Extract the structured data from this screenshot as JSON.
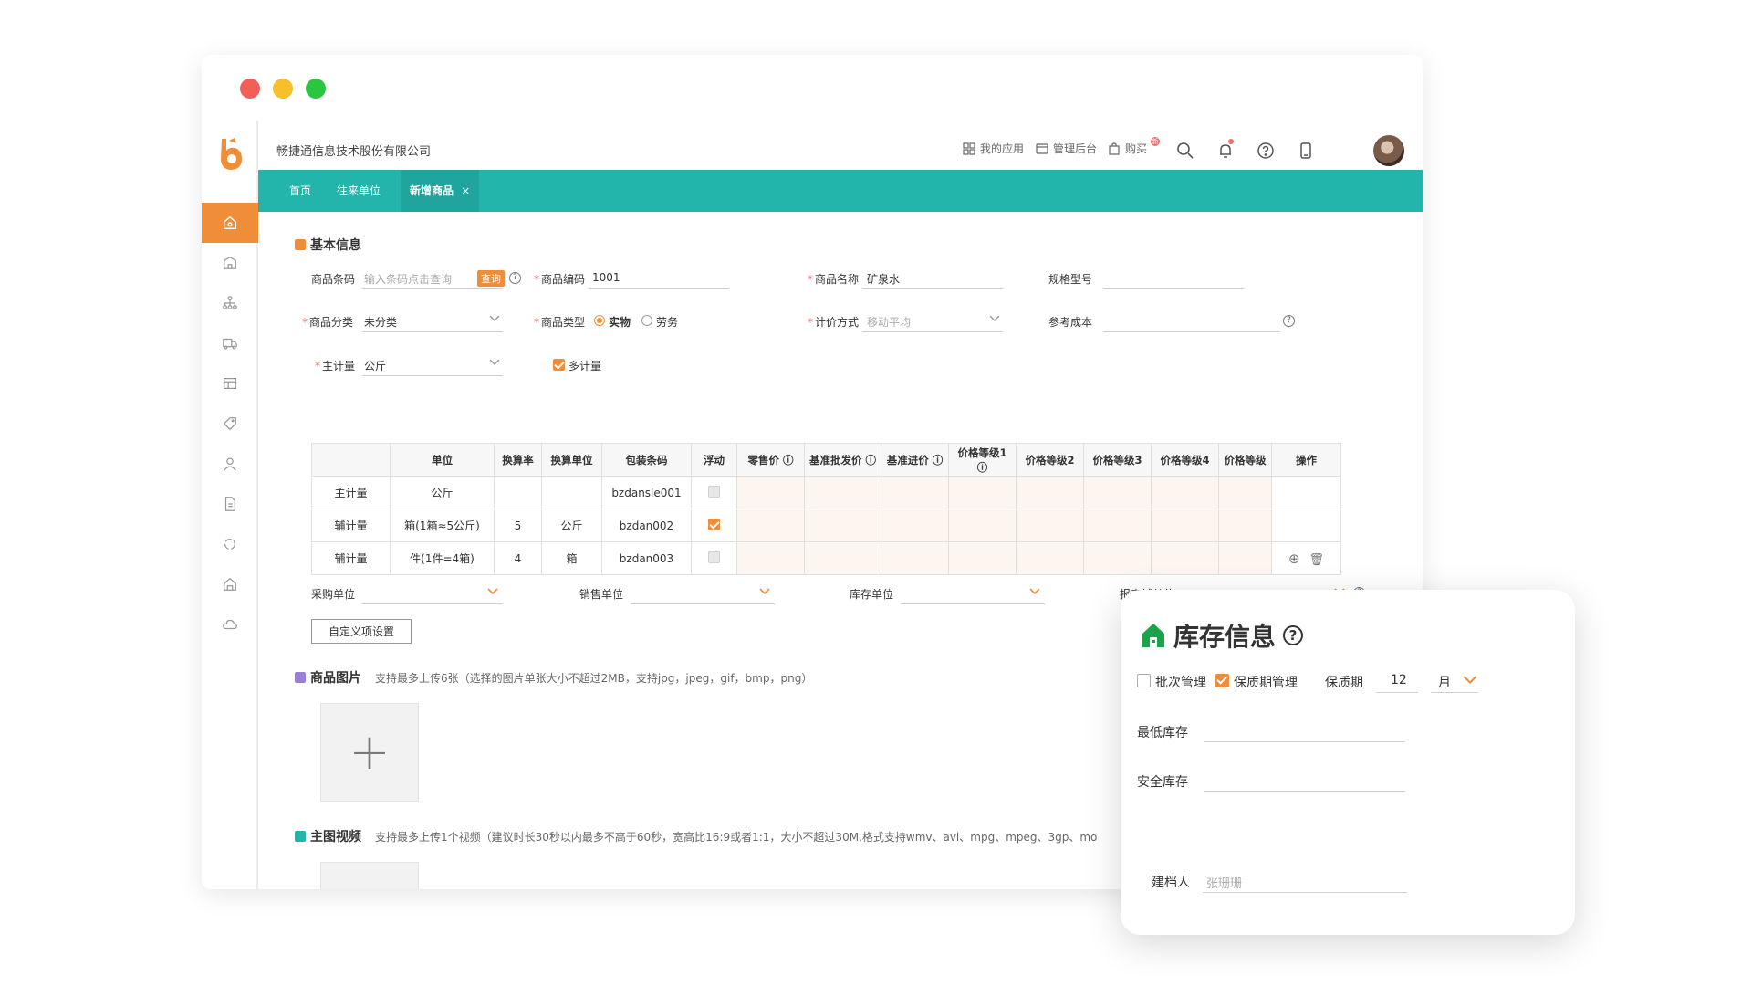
{
  "header": {
    "company": "畅捷通信息技术股份有限公司",
    "links": [
      "我的应用",
      "管理后台",
      "购买"
    ]
  },
  "tabs": [
    "首页",
    "往来单位",
    "新增商品"
  ],
  "basic": {
    "title": "基本信息",
    "barcode_label": "商品条码",
    "barcode_placeholder": "输入条码点击查询",
    "query_btn": "查询",
    "code_label": "商品编码",
    "code_value": "1001",
    "name_label": "商品名称",
    "name_value": "矿泉水",
    "spec_label": "规格型号",
    "category_label": "商品分类",
    "category_value": "未分类",
    "type_label": "商品类型",
    "type_opt1": "实物",
    "type_opt2": "劳务",
    "pricing_label": "计价方式",
    "pricing_value": "移动平均",
    "refcost_label": "参考成本",
    "main_unit_label": "主计量",
    "main_unit_value": "公斤",
    "multi_unit_label": "多计量"
  },
  "units_table": {
    "headers": [
      "",
      "单位",
      "换算率",
      "换算单位",
      "包装条码",
      "浮动",
      "零售价",
      "基准批发价",
      "基准进价",
      "价格等级1",
      "价格等级2",
      "价格等级3",
      "价格等级4",
      "价格等级",
      "操作"
    ],
    "rows": [
      {
        "type": "主计量",
        "unit": "公斤",
        "rate": "",
        "conv": "",
        "barcode": "bzdansle001"
      },
      {
        "type": "辅计量",
        "unit": "箱(1箱≈5公斤)",
        "rate": "5",
        "conv": "公斤",
        "barcode": "bzdan002"
      },
      {
        "type": "辅计量",
        "unit": "件(1件=4箱)",
        "rate": "4",
        "conv": "箱",
        "barcode": "bzdan003"
      }
    ]
  },
  "unit_selects": {
    "purchase": "采购单位",
    "sales": "销售单位",
    "stock": "库存单位",
    "report": "报表辅单位"
  },
  "custom_btn": "自定义项设置",
  "images": {
    "title": "商品图片",
    "desc": "支持最多上传6张（选择的图片单张大小不超过2MB，支持jpg，jpeg，gif，bmp，png）"
  },
  "video": {
    "title": "主图视频",
    "desc": "支持最多上传1个视频（建议时长30秒以内最多不高于60秒，宽高比16:9或者1:1，大小不超过30M,格式支持wmv、avi、mpg、mpeg、3gp、mo"
  },
  "stock": {
    "title": "库存信息",
    "batch": "批次管理",
    "shelf_mgmt": "保质期管理",
    "shelf_label": "保质期",
    "shelf_value": "12",
    "shelf_unit": "月",
    "min_stock": "最低库存",
    "safe_stock": "安全库存",
    "creator_label": "建档人",
    "creator_value": "张珊珊"
  },
  "colors": {
    "accent": "#f08d38",
    "teal": "#23b5ac",
    "green": "#1aa34a"
  }
}
